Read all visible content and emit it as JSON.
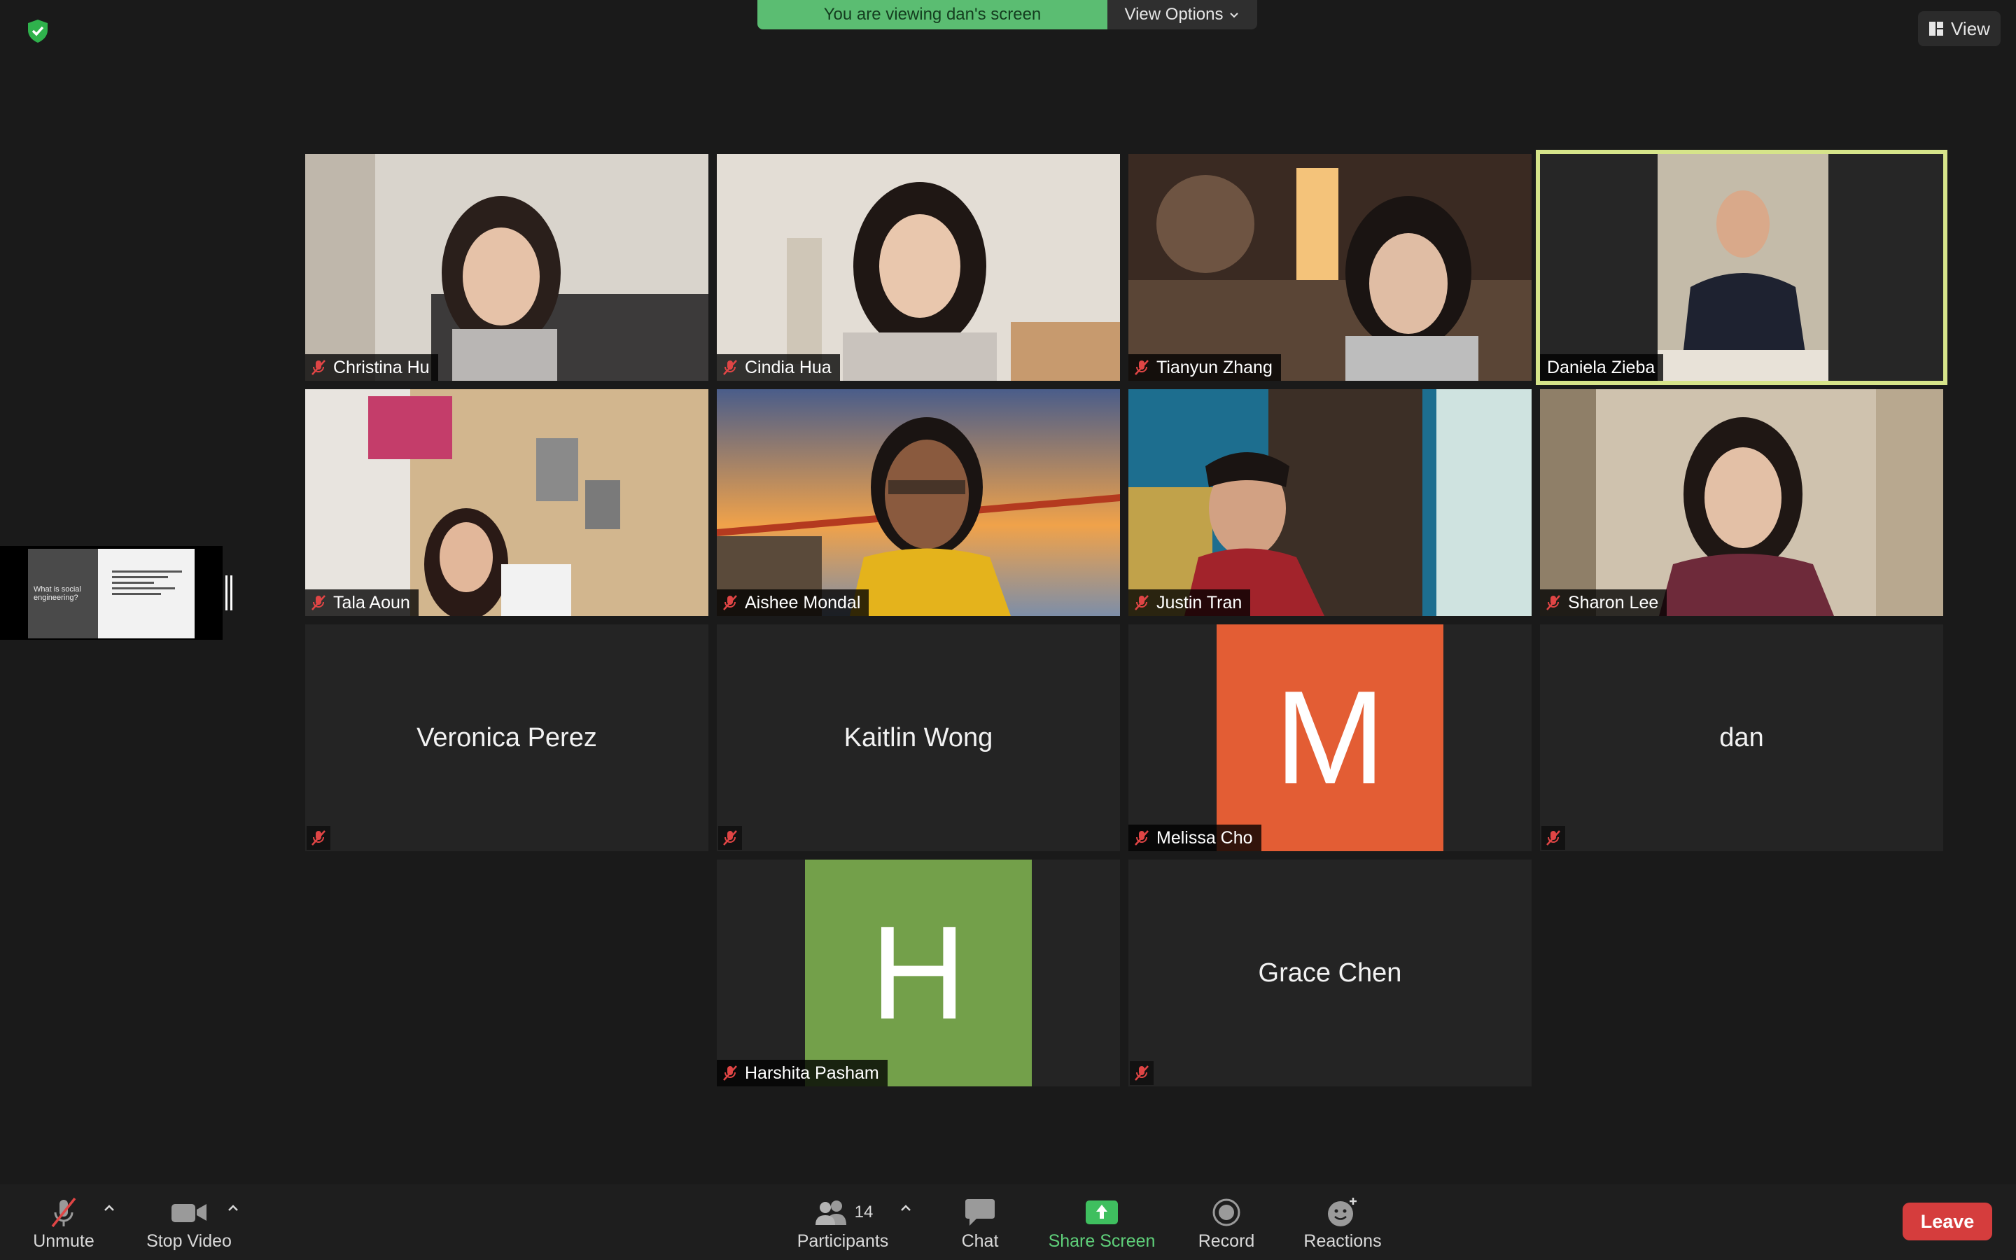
{
  "banner": {
    "text": "You are viewing dan's screen",
    "view_options": "View Options"
  },
  "view_button": "View",
  "participants_grid": [
    {
      "name": "Christina Hu",
      "type": "video",
      "muted": true
    },
    {
      "name": "Cindia Hua",
      "type": "video",
      "muted": true
    },
    {
      "name": "Tianyun Zhang",
      "type": "video",
      "muted": true
    },
    {
      "name": "Daniela Zieba",
      "type": "video",
      "muted": false,
      "active_speaker": true
    },
    {
      "name": "Tala Aoun",
      "type": "video",
      "muted": true
    },
    {
      "name": "Aishee Mondal",
      "type": "video",
      "muted": true
    },
    {
      "name": "Justin Tran",
      "type": "video",
      "muted": true
    },
    {
      "name": "Sharon Lee",
      "type": "video",
      "muted": true
    },
    {
      "name": "Veronica Perez",
      "type": "name-only",
      "muted": true
    },
    {
      "name": "Kaitlin Wong",
      "type": "name-only",
      "muted": true
    },
    {
      "name": "Melissa Cho",
      "type": "avatar",
      "initial": "M",
      "avatar_color": "#e35d34",
      "muted": true
    },
    {
      "name": "dan",
      "type": "name-only",
      "muted": true
    },
    {
      "name": "Harshita Pasham",
      "type": "avatar",
      "initial": "H",
      "avatar_color": "#73a04a",
      "muted": true
    },
    {
      "name": "Grace Chen",
      "type": "name-only",
      "muted": true
    }
  ],
  "shared_screen_thumb": {
    "slide_title": "What is social engineering?"
  },
  "toolbar": {
    "unmute": "Unmute",
    "stop_video": "Stop Video",
    "participants": "Participants",
    "participants_count": "14",
    "chat": "Chat",
    "share_screen": "Share Screen",
    "record": "Record",
    "reactions": "Reactions",
    "leave": "Leave"
  },
  "colors": {
    "banner_green": "#5bbd72",
    "share_green": "#5fd07a",
    "leave_red": "#d53d3d",
    "active_border": "#d6e48a"
  }
}
